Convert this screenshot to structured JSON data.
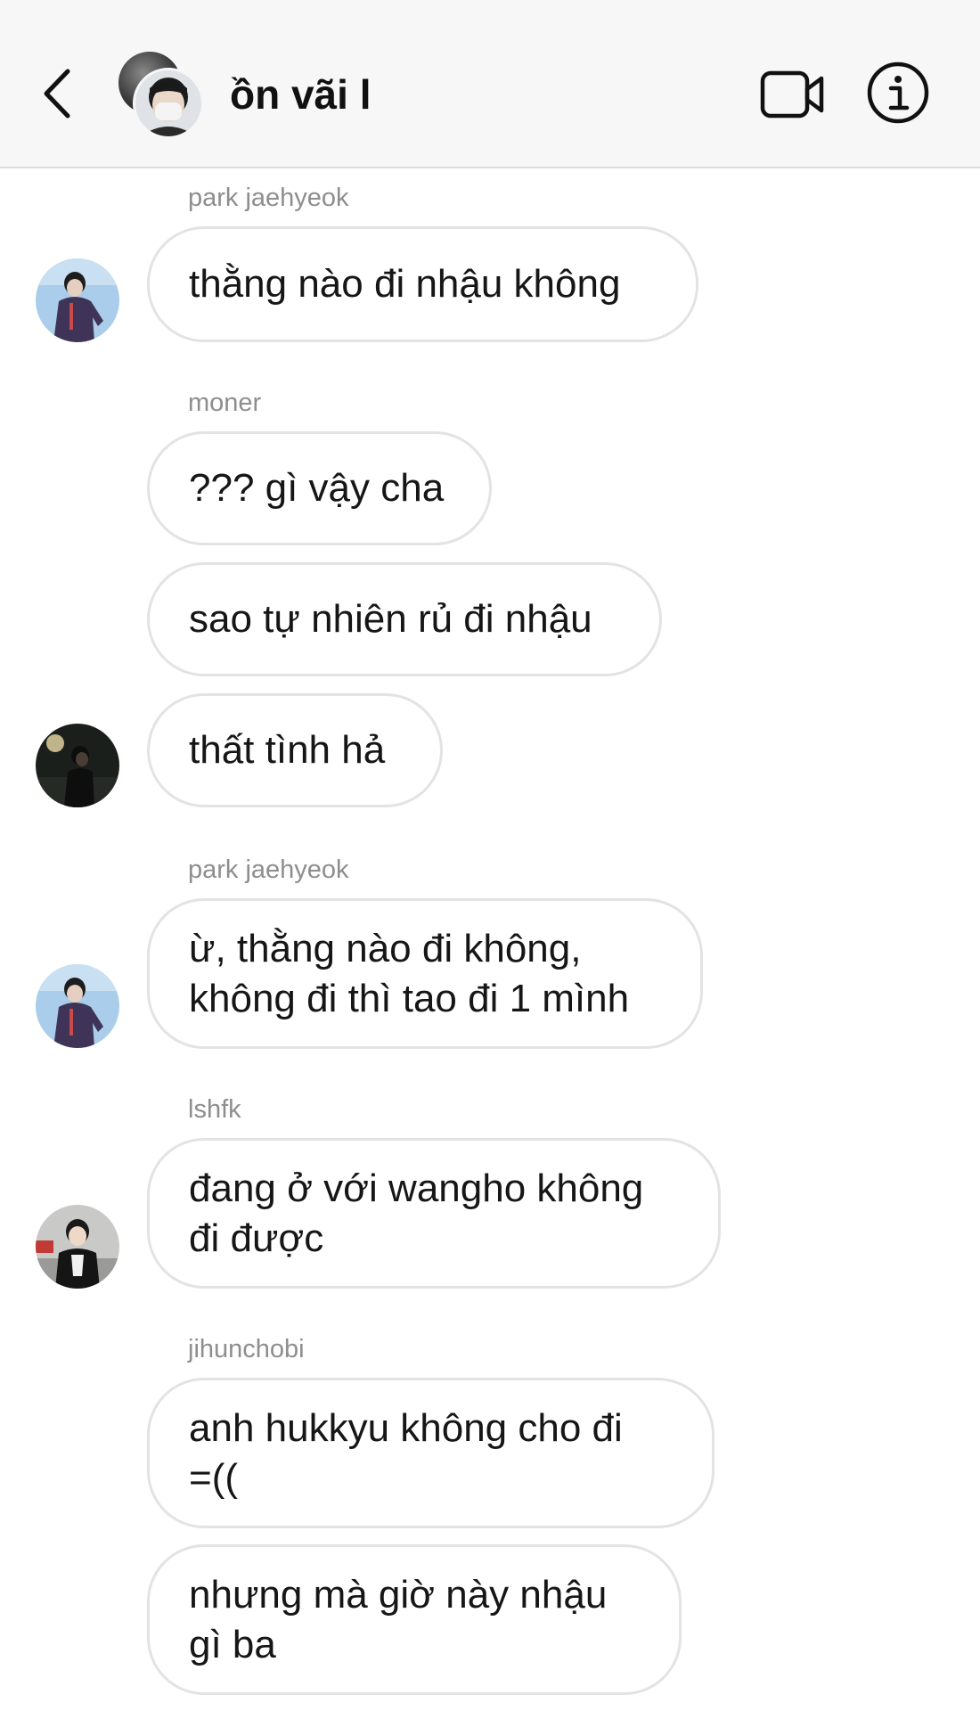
{
  "header": {
    "title": "ồn vãi l",
    "back_icon": "chevron-left-icon",
    "video_icon": "video-camera-icon",
    "info_icon": "info-icon"
  },
  "messages": [
    {
      "sender": "park jaehyeok",
      "bubbles": [
        "thằng nào đi nhậu không"
      ]
    },
    {
      "sender": "moner",
      "bubbles": [
        "??? gì vậy cha",
        "sao tự nhiên rủ đi nhậu",
        "thất tình hả"
      ]
    },
    {
      "sender": "park jaehyeok",
      "bubbles": [
        "ừ, thằng nào đi không,\nkhông đi thì tao đi 1 mình"
      ]
    },
    {
      "sender": "lshfk",
      "bubbles": [
        "đang ở với wangho không\nđi được"
      ]
    },
    {
      "sender": "jihunchobi",
      "bubbles": [
        "anh hukkyu không cho đi\n=((",
        "nhưng mà giờ này nhậu\ngì ba"
      ]
    }
  ],
  "colors": {
    "header_bg": "#f7f7f7",
    "bubble_border": "#e3e3e3",
    "sender_text": "#8e8e8e"
  }
}
